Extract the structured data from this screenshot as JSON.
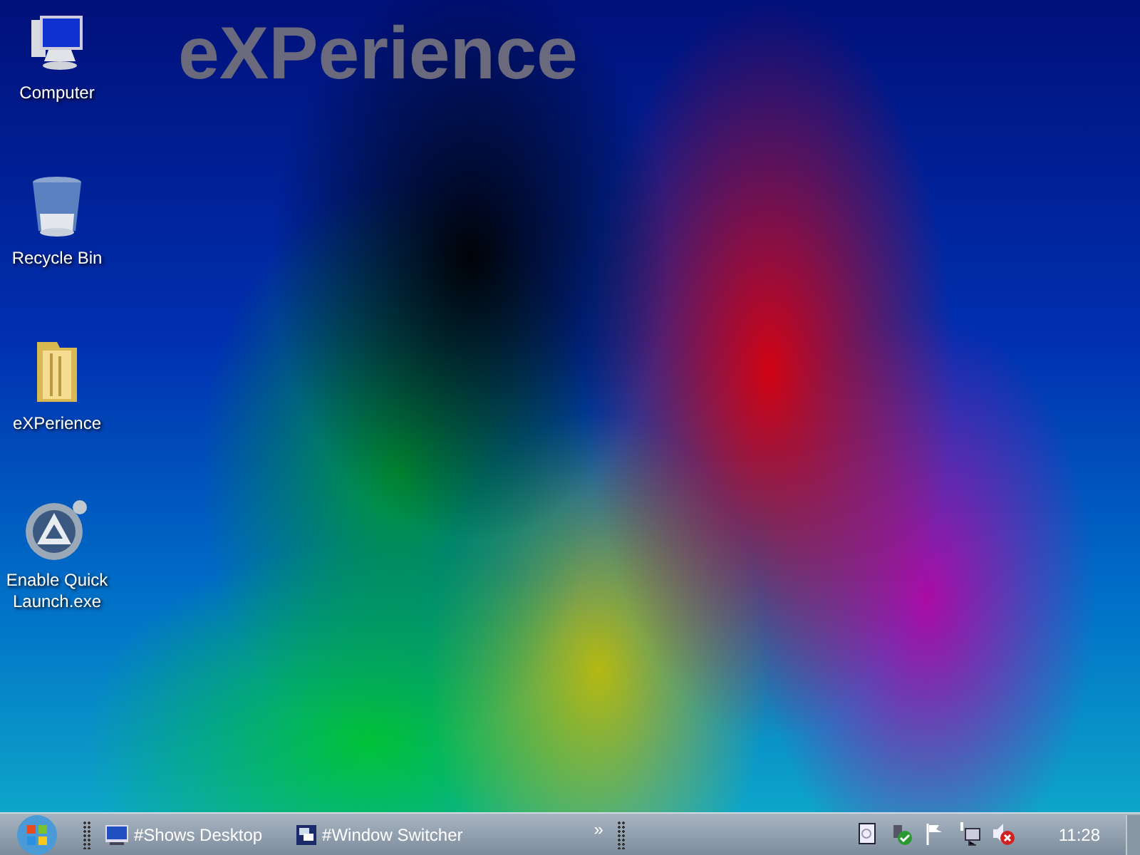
{
  "wallpaper_text": "eXPerience",
  "desktop_icons": [
    {
      "kind": "computer",
      "label": "Computer"
    },
    {
      "kind": "recycle-bin",
      "label": "Recycle Bin"
    },
    {
      "kind": "folder",
      "label": "eXPerience"
    },
    {
      "kind": "app",
      "label": "Enable Quick Launch.exe"
    }
  ],
  "taskbar": {
    "buttons": [
      {
        "kind": "desktop",
        "label": "#Shows Desktop"
      },
      {
        "kind": "switcher",
        "label": "#Window Switcher"
      }
    ],
    "overflow": "»",
    "tray_icons": [
      {
        "kind": "document"
      },
      {
        "kind": "security"
      },
      {
        "kind": "flag"
      },
      {
        "kind": "network"
      },
      {
        "kind": "volume-muted"
      }
    ],
    "clock": "11:28"
  }
}
